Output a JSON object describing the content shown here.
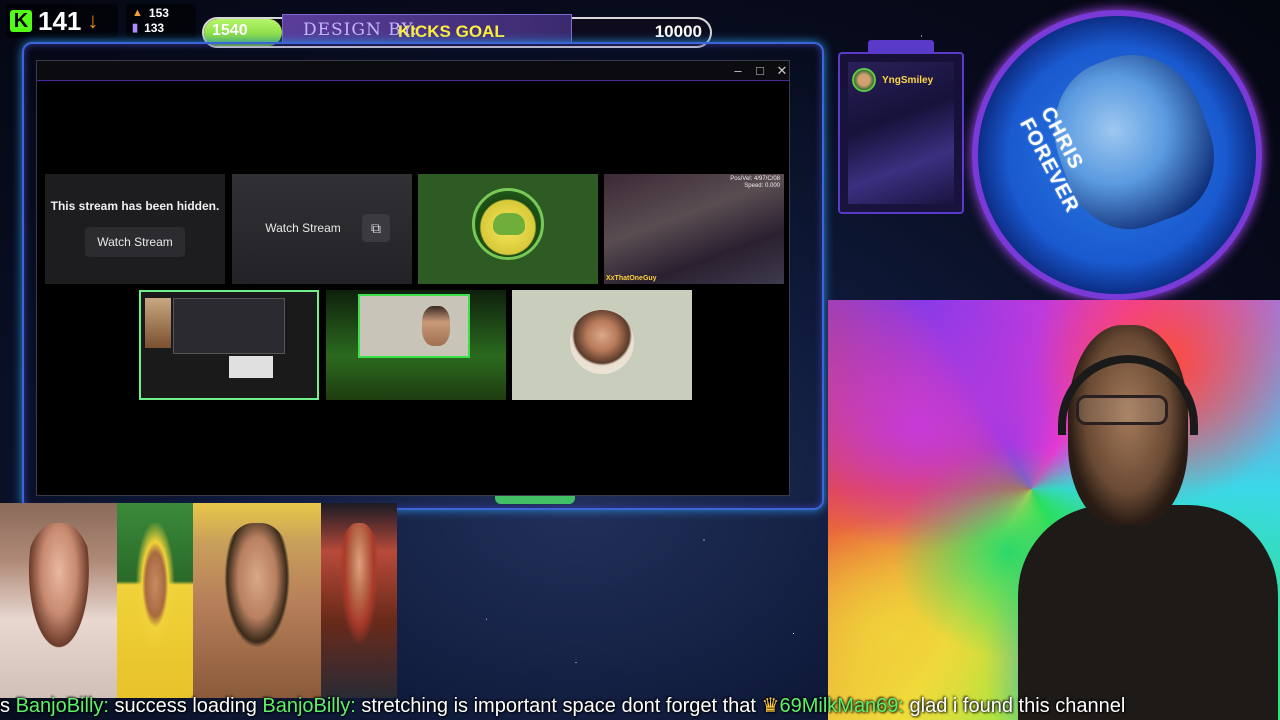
{
  "overlay": {
    "kick_count": "141",
    "viewers": "153",
    "followers": "133"
  },
  "goal": {
    "current": "1540",
    "title": "KICKS GOAL",
    "target": "10000",
    "progress": 0.154,
    "design_by": "DESIGN BY:"
  },
  "window": {
    "minimize": "–",
    "maximize": "□",
    "close": "✕"
  },
  "streams": [
    {
      "hidden_text": "This stream has been hidden.",
      "button": "Watch Stream"
    },
    {
      "button": "Watch Stream",
      "icon": "popout-icon"
    },
    {
      "icon": "pepe-avatar"
    },
    {
      "hud_line1": "Pos/Vel: 4/97/C/08",
      "hud_line2": "Speed: 0.000",
      "tag": "XxThatOneGuy"
    },
    {
      "icon": "screen-share"
    },
    {
      "icon": "webcam"
    },
    {
      "icon": "profile-avatar"
    }
  ],
  "chat_panel": {
    "username": "YngSmiley"
  },
  "emblem": {
    "line1": "CHRIS",
    "line2": "FOREVER"
  },
  "ticker": [
    {
      "user": "s ",
      "message": ""
    },
    {
      "user": "BanjoBilly:",
      "message": " success loading "
    },
    {
      "user": "BanjoBilly:",
      "message": " stretching is important space dont forget that "
    },
    {
      "crown": "♛",
      "user": "69MilkMan69:",
      "message": " glad i found this channel"
    }
  ]
}
